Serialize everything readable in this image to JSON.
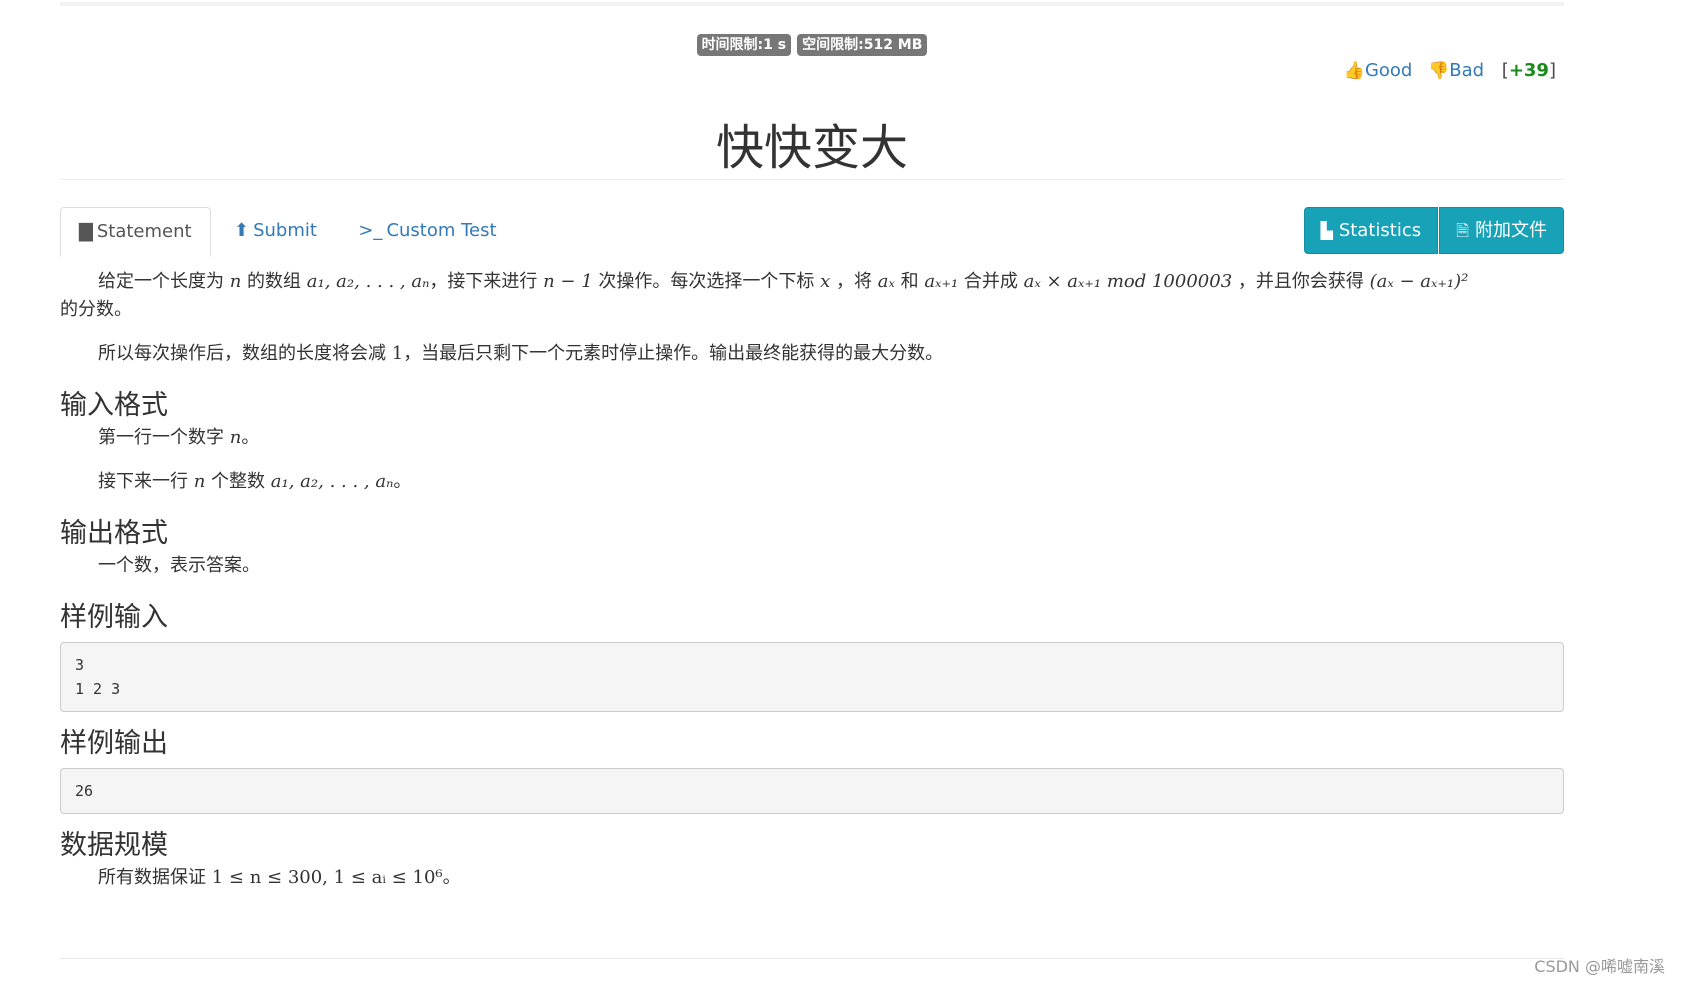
{
  "limits": {
    "time": "时间限制:1 s",
    "memory": "空间限制:512 MB"
  },
  "votes": {
    "good": "Good",
    "bad": "Bad",
    "score_open": "[",
    "score": "+39",
    "score_close": "]"
  },
  "problem": {
    "title": "快快变大"
  },
  "tabs": [
    {
      "label": "Statement",
      "icon": "book-icon"
    },
    {
      "label": "Submit",
      "icon": "upload-circle-icon"
    },
    {
      "label": "Custom Test",
      "icon": "terminal-icon"
    }
  ],
  "buttons": {
    "statistics": "Statistics",
    "attachments": "附加文件"
  },
  "statement": {
    "p1_a": "给定一个长度为 ",
    "p1_b": " 的数组 ",
    "p1_c": "，接下来进行 ",
    "p1_d": " 次操作。每次选择一个下标 ",
    "p1_e": " ，将 ",
    "p1_f": " 和 ",
    "p1_g": " 合并成 ",
    "p1_h": " ，并且你会获得 ",
    "p1_i": "的分数。",
    "m_n": "n",
    "m_arr": "a₁, a₂, . . . , aₙ",
    "m_n1": "n − 1",
    "m_x": "x",
    "m_ax": "aₓ",
    "m_ax1": "aₓ₊₁",
    "m_merge": "aₓ × aₓ₊₁ mod 1000003",
    "m_score": "(aₓ − aₓ₊₁)²",
    "p2_a": "所以每次操作后，数组的长度将会减 ",
    "p2_m": "1",
    "p2_b": "，当最后只剩下一个元素时停止操作。输出最终能获得的最大分数。"
  },
  "input_format": {
    "heading": "输入格式",
    "l1_a": "第一行一个数字 ",
    "l1_m": "n",
    "l1_b": "。",
    "l2_a": "接下来一行 ",
    "l2_m": "n",
    "l2_b": " 个整数 ",
    "l2_m2": "a₁, a₂, . . . , aₙ",
    "l2_c": "。"
  },
  "output_format": {
    "heading": "输出格式",
    "text": "一个数，表示答案。"
  },
  "sample_input": {
    "heading": "样例输入",
    "content": "3\n1 2 3"
  },
  "sample_output": {
    "heading": "样例输出",
    "content": "26"
  },
  "constraints": {
    "heading": "数据规模",
    "text_a": "所有数据保证 ",
    "math": "1 ≤ n ≤ 300, 1 ≤ aᵢ ≤ 10⁶",
    "text_b": "。"
  },
  "watermark": "CSDN @唏嘘南溪"
}
